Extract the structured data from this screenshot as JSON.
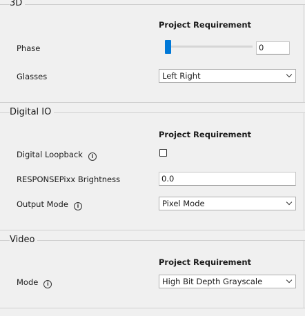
{
  "sections": {
    "s3d": {
      "title": "3D",
      "column_header": "Project Requirement",
      "phase": {
        "label": "Phase",
        "value": "0",
        "slider_fraction": 0
      },
      "glasses": {
        "label": "Glasses",
        "value": "Left Right"
      }
    },
    "digital_io": {
      "title": "Digital IO",
      "column_header": "Project Requirement",
      "digital_loopback": {
        "label": "Digital Loopback",
        "checked": false
      },
      "responsepixx_brightness": {
        "label": "RESPONSEPixx Brightness",
        "value": "0.0"
      },
      "output_mode": {
        "label": "Output Mode",
        "value": "Pixel Mode"
      }
    },
    "video": {
      "title": "Video",
      "column_header": "Project Requirement",
      "mode": {
        "label": "Mode",
        "value": "High Bit Depth Grayscale"
      }
    }
  },
  "icons": {
    "info": "i",
    "dropdown": "chevron-down-icon"
  },
  "colors": {
    "accent": "#0078d7",
    "background": "#f0f0f0",
    "border": "#cfcfcf"
  }
}
